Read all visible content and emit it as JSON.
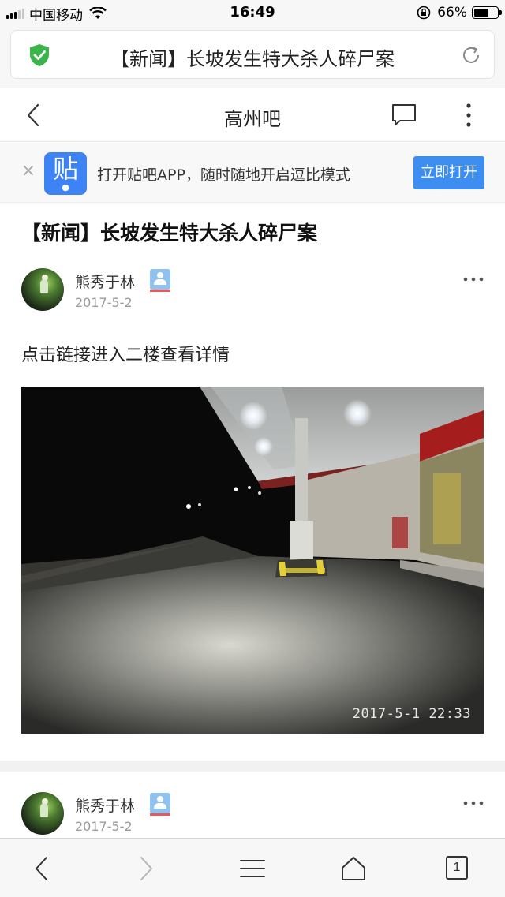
{
  "status_bar": {
    "carrier": "中国移动",
    "time": "16:49",
    "battery_percent": "66%",
    "battery_level": 0.66,
    "signal_bars_on": 3,
    "signal_bars_total": 5
  },
  "url_bar": {
    "title": "【新闻】长坡发生特大杀人碎尸案",
    "secure_icon": "shield-check-icon",
    "reload_icon": "reload-icon"
  },
  "header": {
    "title": "高州吧",
    "back_icon": "chevron-left-icon",
    "comment_icon": "comment-icon",
    "more_icon": "more-vertical-icon"
  },
  "app_banner": {
    "app_icon_text": "贴",
    "text": "打开贴吧APP，随时随地开启逗比模式",
    "button": "立即打开",
    "accent_color": "#3d8ef0"
  },
  "post": {
    "title": "【新闻】长坡发生特大杀人碎尸案",
    "body": "点击链接进入二楼查看详情",
    "photo_timestamp": "2017-5-1 22:33"
  },
  "floors": [
    {
      "author": "熊秀于林",
      "date": "2017-5-2"
    },
    {
      "author": "熊秀于林",
      "date": "2017-5-2"
    }
  ],
  "toolbar": {
    "tab_count": "1",
    "icons": [
      "back-icon",
      "forward-icon",
      "menu-icon",
      "home-icon",
      "tabs-icon"
    ]
  }
}
